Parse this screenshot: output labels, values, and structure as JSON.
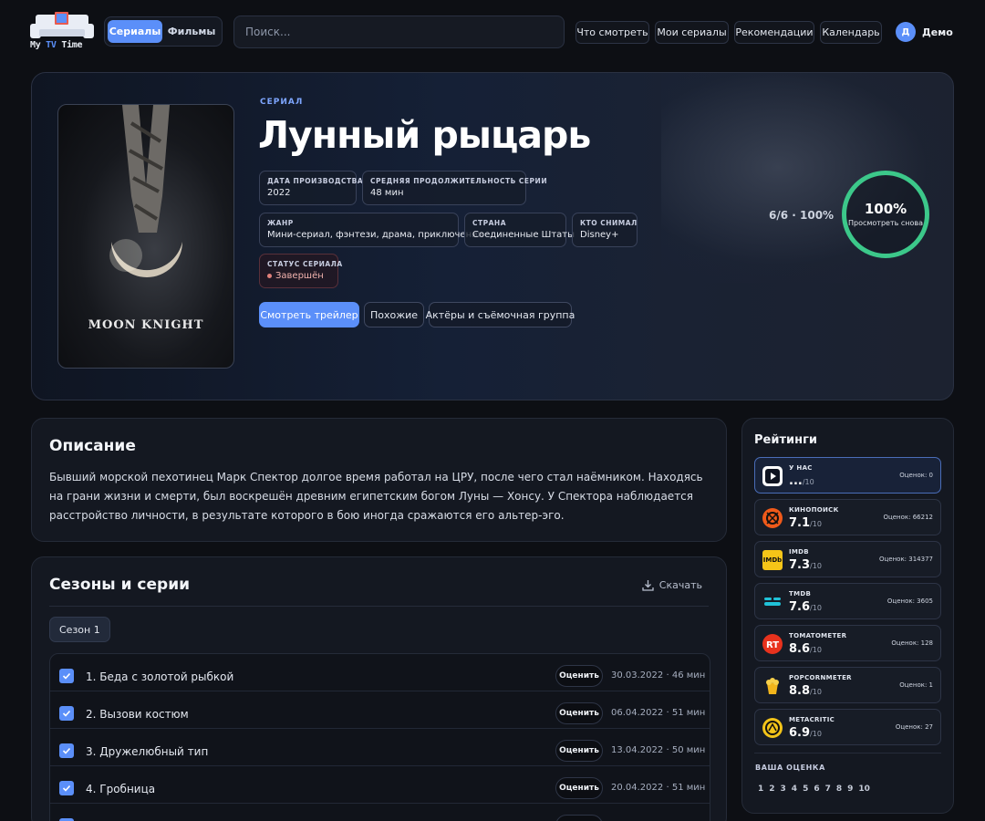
{
  "logo": {
    "text_before": "My ",
    "text_tv": "TV",
    "text_after": " Time"
  },
  "type_toggle": {
    "series_label": "Сериалы",
    "movies_label": "Фильмы"
  },
  "search": {
    "placeholder": "Поиск..."
  },
  "nav": {
    "what_to_watch": "Что смотреть",
    "my_series": "Мои сериалы",
    "recommendations": "Рекомендации",
    "calendar": "Календарь"
  },
  "user": {
    "initial": "Д",
    "name": "Демо"
  },
  "show": {
    "kind": "СЕРИАЛ",
    "title": "Лунный рыцарь",
    "poster_title": "MOON KNIGHT",
    "production_date_label": "Дата производства",
    "production_date": "2022",
    "duration_label": "Средняя продолжительность серии",
    "duration": "48 мин",
    "genre_label": "Жанр",
    "genre": "Мини-сериал, фэнтези, драма, приключения",
    "country_label": "Страна",
    "country": "Соединенные Штаты",
    "studio_label": "Кто снимал",
    "studio": "Disney+",
    "status_label": "Статус сериала",
    "status": "Завершён",
    "buttons": {
      "trailer": "Смотреть трейлер",
      "similar": "Похожие",
      "cast": "Актёры и съёмочная группа"
    },
    "progress_text": "6/6 · 100%",
    "progress_fraction": 1.0,
    "ring_pct": "100%",
    "ring_sub": "Просмотреть снова"
  },
  "description": {
    "heading": "Описание",
    "text": "Бывший морской пехотинец Марк Спектор долгое время работал на ЦРУ, после чего стал наёмником. Находясь на грани жизни и смерти, был воскрешён древним египетским богом Луны — Хонсу. У Спектора наблюдается расстройство личности, в результате которого в бою иногда сражаются его альтер-эго."
  },
  "seasons": {
    "heading": "Сезоны и серии",
    "download_label": "Скачать",
    "season_tab": "Сезон 1",
    "rate_label": "Оценить",
    "episodes": [
      {
        "title": "1. Беда с золотой рыбкой",
        "date": "30.03.2022",
        "sep": "·",
        "duration": "46 мин",
        "watched": true
      },
      {
        "title": "2. Вызови костюм",
        "date": "06.04.2022",
        "sep": "·",
        "duration": "51 мин",
        "watched": true
      },
      {
        "title": "3. Дружелюбный тип",
        "date": "13.04.2022",
        "sep": "·",
        "duration": "50 мин",
        "watched": true
      },
      {
        "title": "4. Гробница",
        "date": "20.04.2022",
        "sep": "·",
        "duration": "51 мин",
        "watched": true
      }
    ]
  },
  "ratings": {
    "heading": "Рейтинги",
    "items": [
      {
        "name": "У НАС",
        "score": "...",
        "of": "/10",
        "votes": "Оценок: 0"
      },
      {
        "name": "КИНОПОИСК",
        "score": "7.1",
        "of": "/10",
        "votes": "Оценок: 66212"
      },
      {
        "name": "IMDB",
        "score": "7.3",
        "of": "/10",
        "votes": "Оценок: 314377"
      },
      {
        "name": "TMDB",
        "score": "7.6",
        "of": "/10",
        "votes": "Оценок: 3605"
      },
      {
        "name": "TOMATOMETER",
        "score": "8.6",
        "of": "/10",
        "votes": "Оценок: 128"
      },
      {
        "name": "POPCORNMETER",
        "score": "8.8",
        "of": "/10",
        "votes": "Оценок: 1"
      },
      {
        "name": "METACRITIC",
        "score": "6.9",
        "of": "/10",
        "votes": "Оценок: 27"
      }
    ],
    "your_rating_label": "ВАША ОЦЕНКА",
    "scale": [
      "1",
      "2",
      "3",
      "4",
      "5",
      "6",
      "7",
      "8",
      "9",
      "10"
    ]
  },
  "colors": {
    "accent": "#5b8ff9",
    "progress": "#3cc88a",
    "status": "#e0807a"
  }
}
